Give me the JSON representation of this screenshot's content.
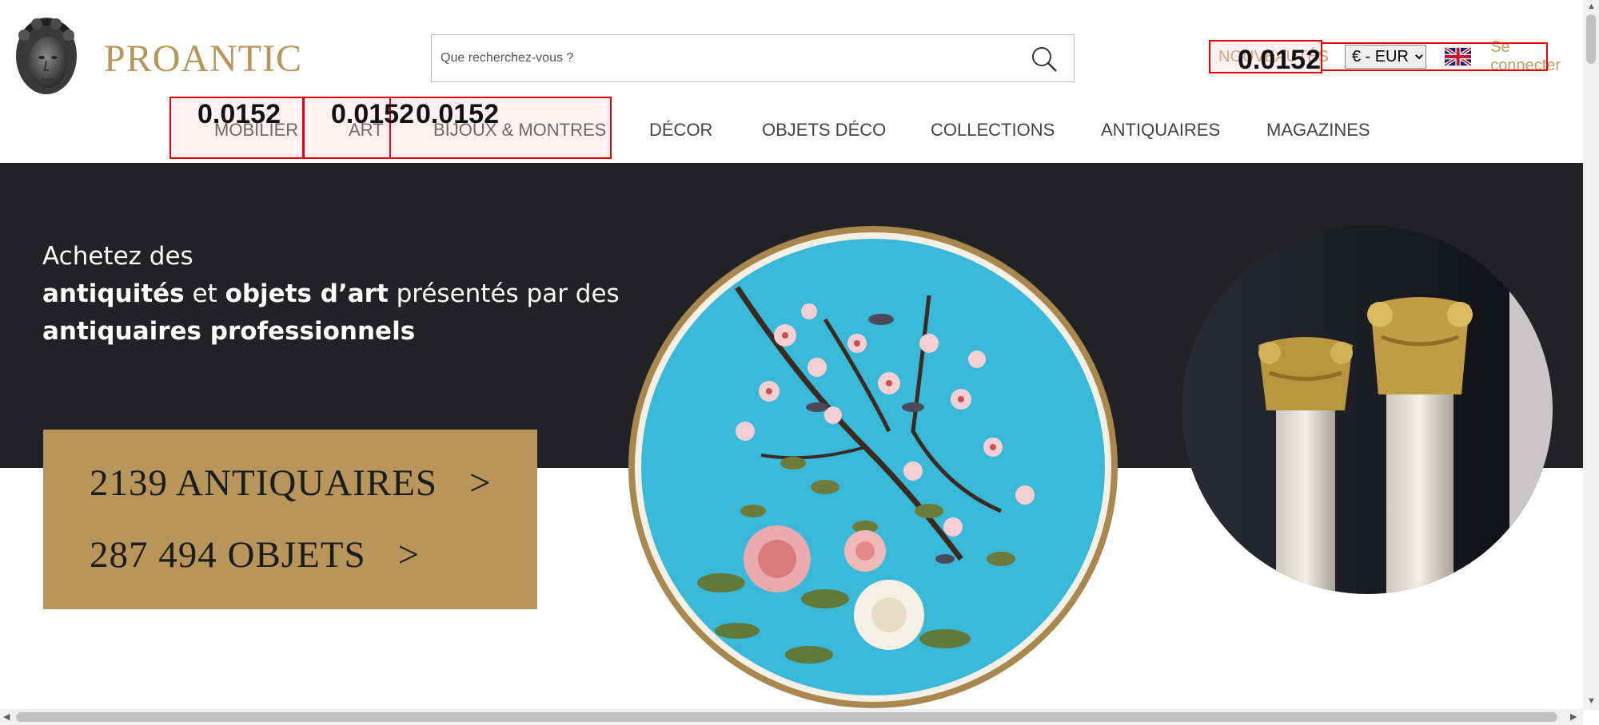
{
  "brand": {
    "name": "PROANTIC"
  },
  "search": {
    "placeholder": "Que recherchez-vous ?"
  },
  "top_bar": {
    "nouveautes": "NOUVEAUTÉS",
    "currency": "€ - EUR",
    "currency_options": [
      "€ - EUR"
    ],
    "login": "Se connecter"
  },
  "nav": {
    "items": [
      {
        "label": "MOBILIER"
      },
      {
        "label": "ART"
      },
      {
        "label": "BIJOUX & MONTRES"
      },
      {
        "label": "DÉCOR"
      },
      {
        "label": "OBJETS DÉCO"
      },
      {
        "label": "COLLECTIONS"
      },
      {
        "label": "ANTIQUAIRES"
      },
      {
        "label": "MAGAZINES"
      }
    ]
  },
  "overlays": [
    {
      "label": "0.0152"
    },
    {
      "label": "0.0152"
    },
    {
      "label": "0.0152"
    },
    {
      "label": "0.0152"
    }
  ],
  "hero": {
    "line1": "Achetez des",
    "bold1": "antiquités",
    "mid1": " et ",
    "bold2": "objets d’art",
    "mid2": " présentés par des",
    "bold3": "antiquaires professionnels",
    "stat1": "2139 ANTIQUAIRES",
    "stat2": "287 494 OBJETS",
    "arrow": ">"
  },
  "colors": {
    "brand_gold": "#b8955a",
    "link_gold": "#c39a68",
    "hero_dark": "#222224",
    "overlay_red": "#e60000"
  },
  "icons": [
    "medusa-logo-icon",
    "search-icon",
    "uk-flag-icon",
    "chevron-right-icon"
  ]
}
